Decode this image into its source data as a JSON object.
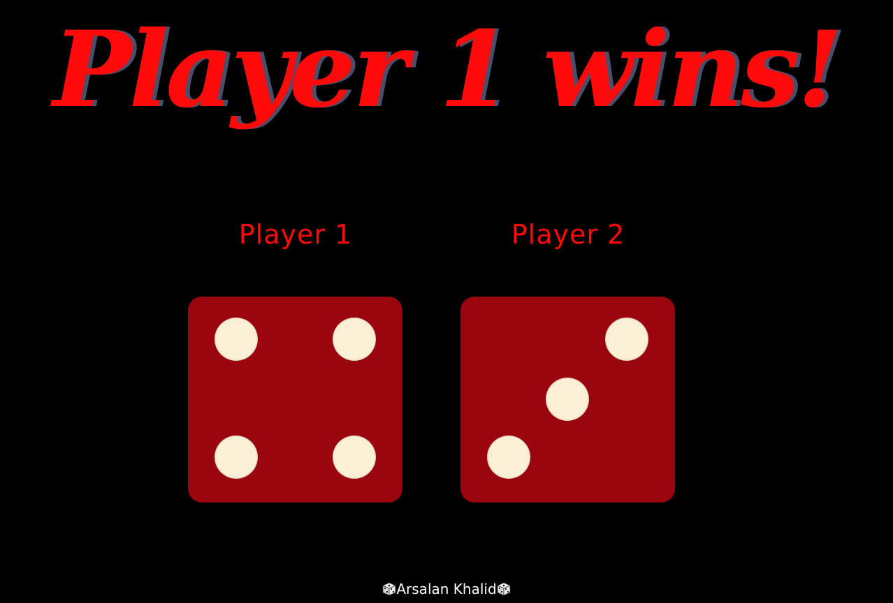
{
  "header": {
    "title": "Player 1 wins!"
  },
  "players": [
    {
      "label": "Player 1",
      "die_value": 4
    },
    {
      "label": "Player 2",
      "die_value": 3
    }
  ],
  "footer": {
    "text": "Arsalan Khalid",
    "icon": "die-icon"
  },
  "colors": {
    "background": "#000000",
    "title": "#ff0a0a",
    "title_shadow": "#4a4e69",
    "die_face": "#9a050e",
    "pip": "#fbefd6",
    "footer_text": "#ffffff"
  }
}
